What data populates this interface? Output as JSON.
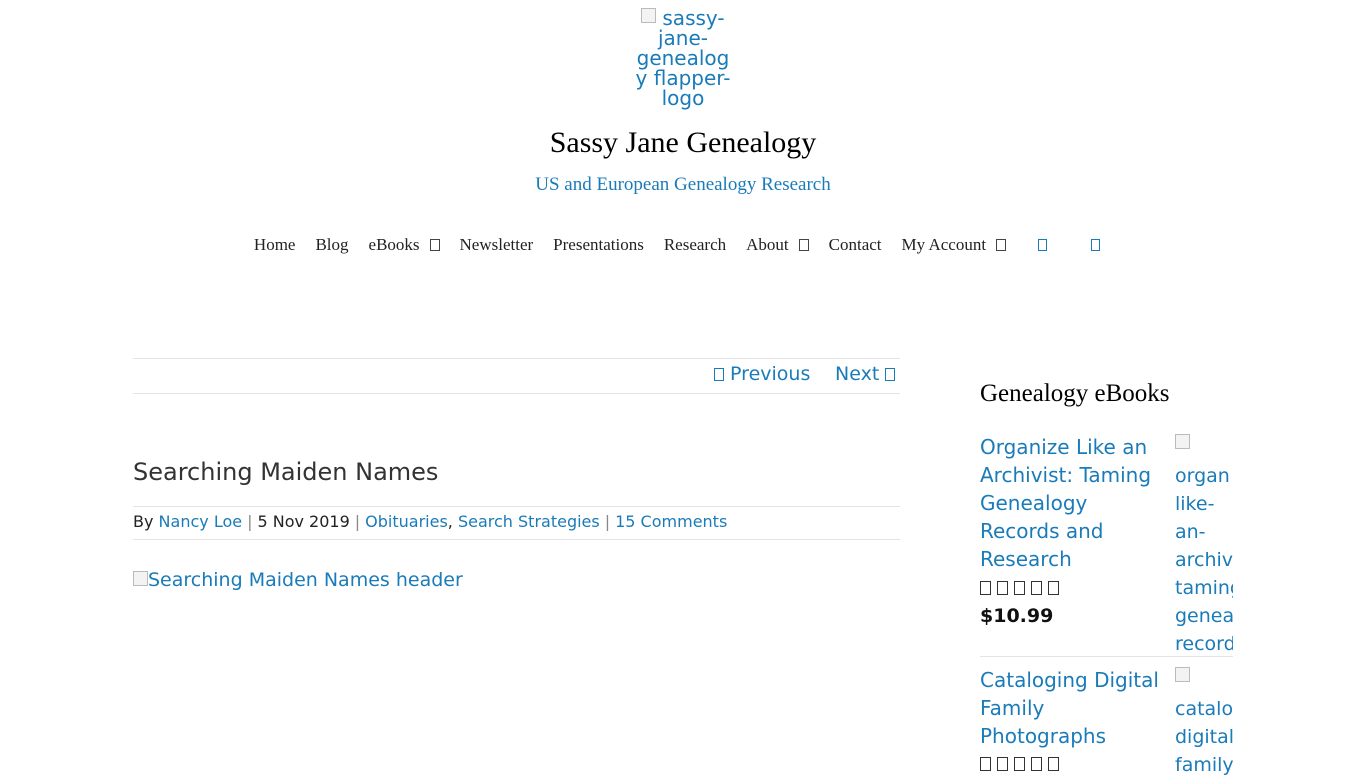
{
  "logo": {
    "alt": "sassy-jane-genealogy flapper-logo"
  },
  "site": {
    "title": "Sassy Jane Genealogy",
    "tagline": "US and European Genealogy Research"
  },
  "nav": {
    "home": "Home",
    "blog": "Blog",
    "ebooks": "eBooks",
    "newsletter": "Newsletter",
    "presentations": "Presentations",
    "research": "Research",
    "about": "About",
    "contact": "Contact",
    "account": "My Account"
  },
  "post_nav": {
    "previous": "Previous",
    "next": "Next"
  },
  "post": {
    "title": "Searching Maiden Names",
    "by": "By",
    "author": "Nancy Loe",
    "date": "5 Nov 2019",
    "category1": "Obituaries",
    "category2": "Search Strategies",
    "comments": "15 Comments",
    "header_alt": "Searching Maiden Names header"
  },
  "sidebar": {
    "title": "Genealogy eBooks",
    "products": [
      {
        "name": "Organize Like an Archivist: Taming Genealogy Records and Research",
        "price": "$10.99",
        "thumb_alt_lines": [
          "organ",
          "like-",
          "an-",
          "archiv",
          "taming",
          "genea",
          "record"
        ]
      },
      {
        "name": "Cataloging Digital Family Photographs",
        "thumb_alt_lines": [
          "catalo",
          "digital",
          "family"
        ]
      }
    ]
  }
}
